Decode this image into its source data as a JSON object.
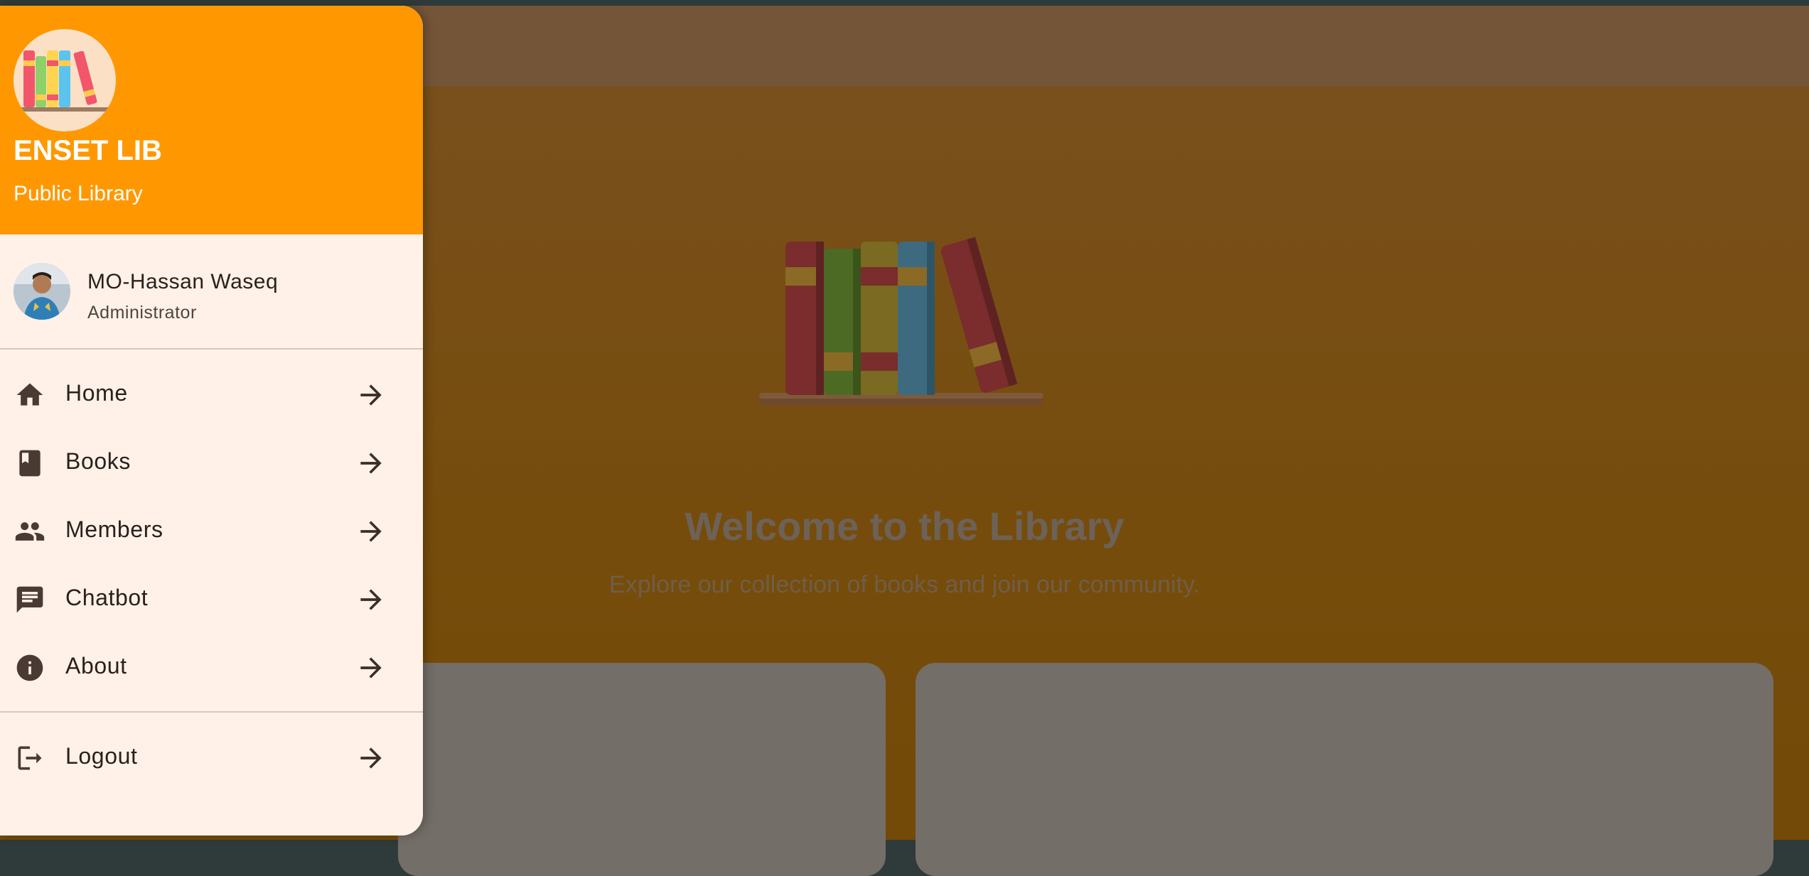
{
  "hero": {
    "title": "Welcome to the Library",
    "subtitle": "Explore our collection of books and join our community."
  },
  "drawer": {
    "app_name": "ENSET LIB",
    "tagline": "Public Library",
    "logo_icon": "bookshelf-icon",
    "user": {
      "name": "MO-Hassan Waseq",
      "role": "Administrator"
    },
    "nav": [
      {
        "label": "Home",
        "icon": "home-icon"
      },
      {
        "label": "Books",
        "icon": "book-icon"
      },
      {
        "label": "Members",
        "icon": "people-icon"
      },
      {
        "label": "Chatbot",
        "icon": "chat-icon"
      },
      {
        "label": "About",
        "icon": "info-icon"
      }
    ],
    "logout": {
      "label": "Logout",
      "icon": "logout-icon"
    }
  },
  "colors": {
    "drawer_header": "#ff9800",
    "drawer_bg": "#fff1e8",
    "icon": "#4b3a33"
  }
}
